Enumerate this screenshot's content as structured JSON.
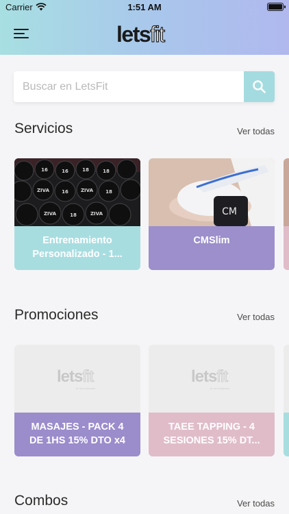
{
  "status_bar": {
    "carrier": "Carrier",
    "time": "1:51 AM"
  },
  "header": {
    "logo_bold": "lets",
    "logo_outline": "fit"
  },
  "search": {
    "placeholder": "Buscar en LetsFit"
  },
  "sections": {
    "servicios": {
      "title": "Servicios",
      "see_all": "Ver todas",
      "cards": [
        {
          "label": "Entrenamiento Personalizado - 1...",
          "color": "#a8dde0"
        },
        {
          "label": "CMSlim",
          "color": "#9c8fcb"
        }
      ]
    },
    "promociones": {
      "title": "Promociones",
      "see_all": "Ver todas",
      "cards": [
        {
          "label": "MASAJES - PACK 4 DE 1HS 15% DTO x4",
          "color": "#9b8ccc"
        },
        {
          "label": "TAEE TAPPING - 4 SESIONES 15% DT...",
          "color": "#e0bcc9"
        }
      ]
    },
    "combos": {
      "title": "Combos",
      "see_all": "Ver todas"
    }
  },
  "placeholder_logo": {
    "bold": "lets",
    "outline": "fit",
    "sub": "BY LETI GONZALEZ"
  },
  "colors": {
    "header_start": "#a7dfe2",
    "header_end": "#b0b8ee",
    "search_button": "#a4dbe0"
  }
}
